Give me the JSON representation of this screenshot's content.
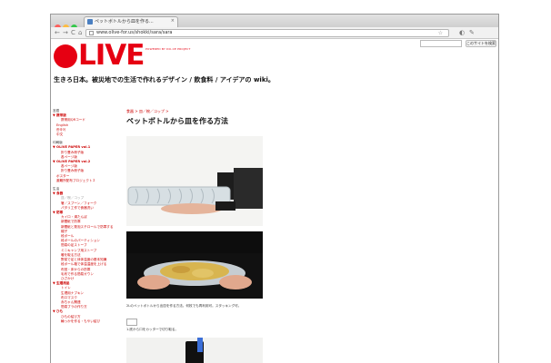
{
  "browser": {
    "tab_title": "ペットボトルから皿を作る...",
    "tab_close": "×",
    "url": "www.olive-for.us/shokki/sara/sara",
    "nav_back": "←",
    "nav_forward": "→",
    "nav_reload": "C",
    "nav_home": "⌂",
    "star": "☆",
    "colors": {
      "close": "#fc605c",
      "minimize": "#fdbc40",
      "zoom": "#34c84a"
    }
  },
  "site": {
    "logo": "LIVE",
    "powered_by": "POWERED BY DO-CE PROJECT",
    "tagline": "生きろ日本。被災地での生活で作れるデザイン / 飲食料 / アイデアの wiki。",
    "search_button": "このサイトを検索",
    "brand_color": "#e60012"
  },
  "sidebar": [
    {
      "text": "言語",
      "kind": "sec"
    },
    {
      "text": "▼ 携帯版",
      "kind": "grp"
    },
    {
      "text": "携帯用QRコード",
      "kind": "sub"
    },
    {
      "text": "English",
      "kind": "leaf"
    },
    {
      "text": "한국어",
      "kind": "leaf"
    },
    {
      "text": "中文",
      "kind": "leaf"
    },
    {
      "text": "印刷版",
      "kind": "sec"
    },
    {
      "text": "▼ OLIVE PAPER vol.1",
      "kind": "grp"
    },
    {
      "text": "折り畳み冊子版",
      "kind": "sub"
    },
    {
      "text": "各ページ版",
      "kind": "sub"
    },
    {
      "text": "▼ OLIVE PAPER vol.2",
      "kind": "grp"
    },
    {
      "text": "各ページ版",
      "kind": "sub"
    },
    {
      "text": "折り畳み冊子版",
      "kind": "sub"
    },
    {
      "text": "ポスター",
      "kind": "leaf"
    },
    {
      "text": "避難所配布プロジェクト２",
      "kind": "leaf"
    },
    {
      "text": "生活",
      "kind": "sec"
    },
    {
      "text": "▼ 食器",
      "kind": "grp"
    },
    {
      "text": "皿／椀／コップ",
      "kind": "sub sel"
    },
    {
      "text": "箸／スプーン／フォーク",
      "kind": "sub"
    },
    {
      "text": "パタリ工作で食器洗い",
      "kind": "sub"
    },
    {
      "text": "▼ 防寒",
      "kind": "grp"
    },
    {
      "text": "カイロ・湯たんぽ",
      "kind": "sub"
    },
    {
      "text": "新聞紙で防寒",
      "kind": "sub"
    },
    {
      "text": "新聞紙と発泡スチロールで防寒する",
      "kind": "sub"
    },
    {
      "text": "帽子",
      "kind": "sub"
    },
    {
      "text": "段ボール",
      "kind": "sub"
    },
    {
      "text": "段ボールのパーティション",
      "kind": "sub"
    },
    {
      "text": "簡易の足ストーブ",
      "kind": "sub"
    },
    {
      "text": "ミニキャンプ用ストーブ",
      "kind": "sub"
    },
    {
      "text": "暖を取る方法",
      "kind": "sub"
    },
    {
      "text": "野菜で足と体体温度の基本知識",
      "kind": "sub"
    },
    {
      "text": "段ボール箱で体温温度を上げる",
      "kind": "sub"
    },
    {
      "text": "布団・床からの防寒",
      "kind": "sub"
    },
    {
      "text": "毛布で作る簡易ガウン",
      "kind": "sub"
    },
    {
      "text": "ひざかけ",
      "kind": "sub"
    },
    {
      "text": "▼ 生理用品",
      "kind": "grp"
    },
    {
      "text": "トイレ",
      "kind": "sub"
    },
    {
      "text": "生理用ナプキン",
      "kind": "sub"
    },
    {
      "text": "布ロマスク",
      "kind": "sub"
    },
    {
      "text": "赤ちゃん関連",
      "kind": "sub"
    },
    {
      "text": "簡易ブラの作り方",
      "kind": "sub"
    },
    {
      "text": "▼ ひも",
      "kind": "grp"
    },
    {
      "text": "ひもの結び方",
      "kind": "sub"
    },
    {
      "text": "輪っかを作る・もやい結び",
      "kind": "sub"
    }
  ],
  "main": {
    "breadcrumb": "食器 > 皿／椀／コップ >",
    "title": "ペットボトルから皿を作る方法",
    "caption": "2Lのペットボトルから出皿を作る方法。何枚でも再利用可。スタッキング可。",
    "step1": "1.底から口をカッターで切り取る。"
  }
}
